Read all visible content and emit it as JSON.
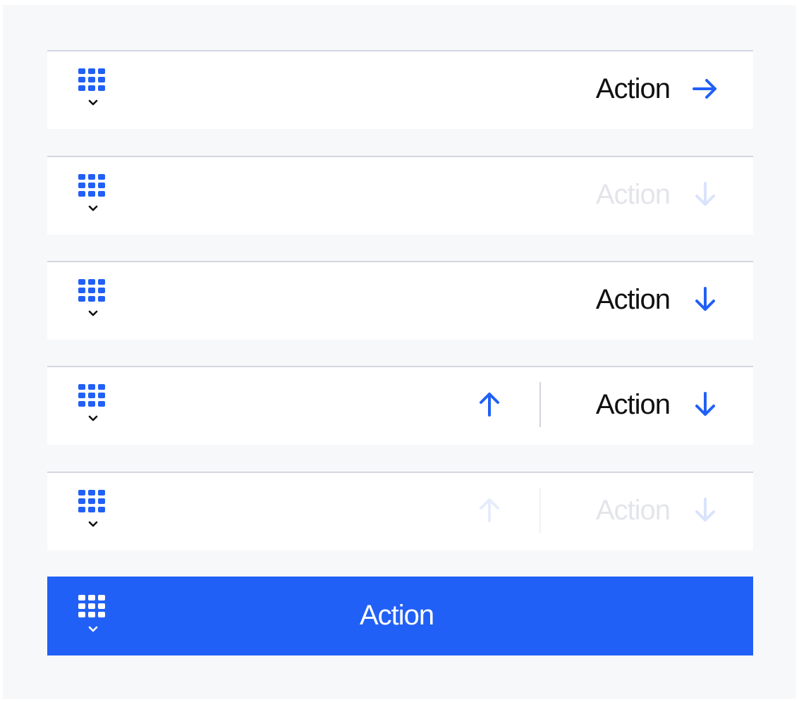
{
  "colors": {
    "accent": "#2160f6",
    "background": "#f7f8fa",
    "bar_border": "#d3d5e0",
    "text": "#111111",
    "disabled_text": "#e4e5ea"
  },
  "icons": {
    "grid": "grid-icon",
    "chevron": "chevron-down-icon",
    "arrow_right": "arrow-right-icon",
    "arrow_down": "arrow-down-icon",
    "arrow_up": "arrow-up-icon"
  },
  "bars": [
    {
      "action_label": "Action",
      "arrow": "right",
      "state": "enabled"
    },
    {
      "action_label": "Action",
      "arrow": "down",
      "state": "disabled"
    },
    {
      "action_label": "Action",
      "arrow": "down",
      "state": "enabled"
    },
    {
      "action_label": "Action",
      "arrow": "down",
      "secondary_arrow": "up",
      "state": "enabled"
    },
    {
      "action_label": "Action",
      "arrow": "down",
      "secondary_arrow": "up",
      "state": "disabled"
    },
    {
      "action_label": "Action",
      "variant": "primary"
    }
  ]
}
